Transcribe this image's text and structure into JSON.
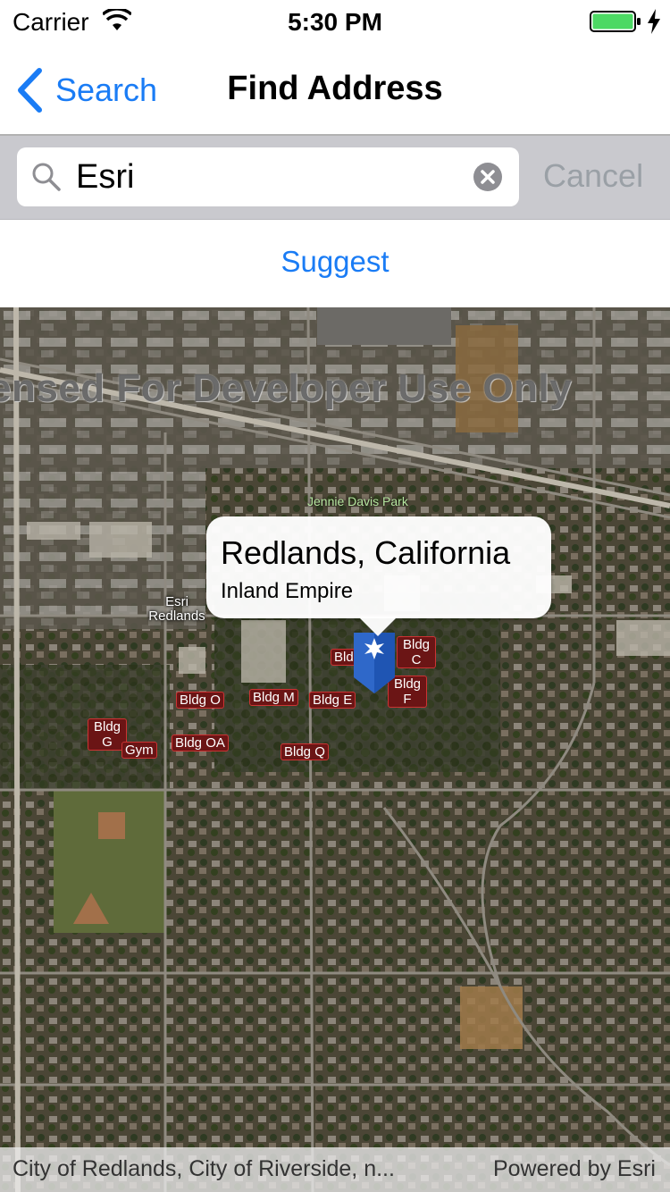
{
  "status_bar": {
    "carrier": "Carrier",
    "time": "5:30 PM",
    "battery_level": 1.0,
    "battery_color": "#4cd964"
  },
  "nav": {
    "back_label": "Search",
    "title": "Find Address",
    "accent_color": "#1a7cf5"
  },
  "search": {
    "value": "Esri",
    "cancel_label": "Cancel"
  },
  "suggest_label": "Suggest",
  "map": {
    "watermark": "ensed For Developer Use Only",
    "callout": {
      "title": "Redlands, California",
      "detail": "Inland Empire"
    },
    "labels": {
      "esri_redlands": "Esri Redlands",
      "park": "Jennie Davis Park",
      "bldg_o": "Bldg O",
      "bldg_m": "Bldg M",
      "bldg_e": "Bldg E",
      "bldg_c": "Bldg C",
      "bldg_f": "Bldg F",
      "bld": "Bld",
      "bldg_g": "Bldg G",
      "gym": "Gym",
      "bldg_oa": "Bldg OA",
      "bldg_q": "Bldg Q"
    },
    "attribution": "City of Redlands, City of Riverside, n...",
    "powered_by": "Powered by Esri"
  }
}
